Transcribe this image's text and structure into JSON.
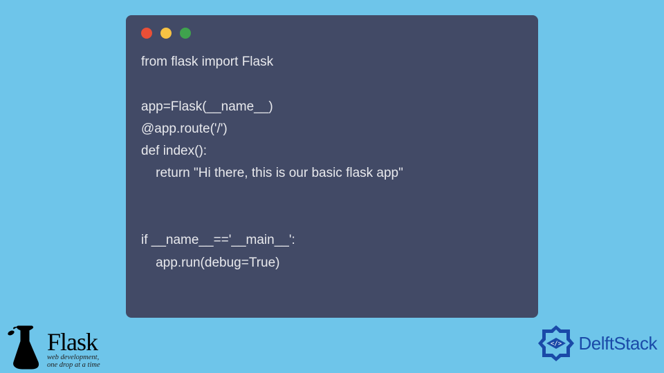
{
  "code": {
    "line1": "from flask import Flask",
    "line2": "",
    "line3": "app=Flask(__name__)",
    "line4": "@app.route('/')",
    "line5": "def index():",
    "line6": "    return \"Hi there, this is our basic flask app\"",
    "line7": "",
    "line8": "",
    "line9": "if __name__=='__main__':",
    "line10": "    app.run(debug=True)"
  },
  "flask": {
    "title": "Flask",
    "subtitle": "web development,\none drop at a time"
  },
  "delft": {
    "title": "DelftStack"
  }
}
